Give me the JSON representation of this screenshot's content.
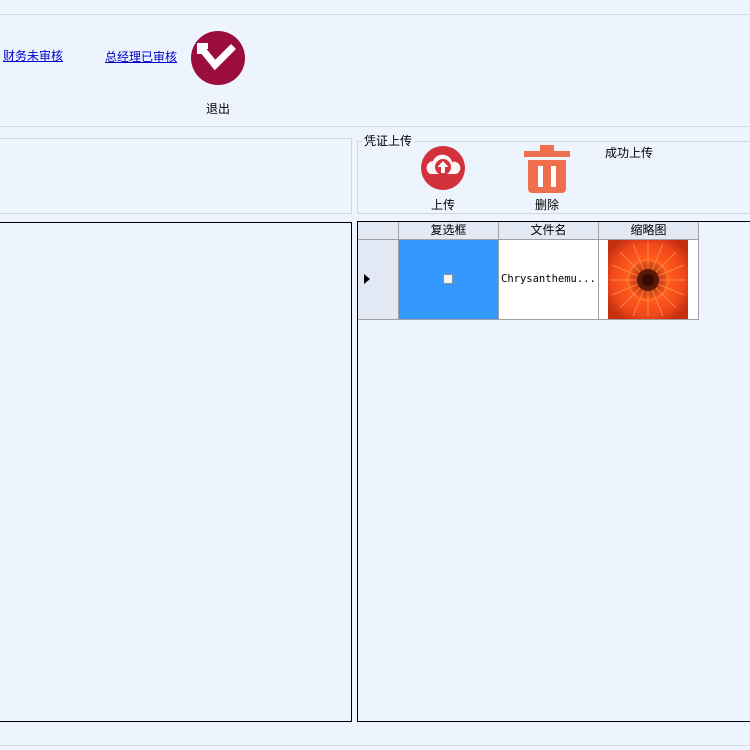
{
  "toolbar": {
    "finance_pending_link": "财务未审核",
    "gm_approved_link": "总经理已审核",
    "exit_label": "退出"
  },
  "voucher_upload": {
    "group_title": "凭证上传",
    "upload_label": "上传",
    "delete_label": "删除",
    "success_label": "成功上传"
  },
  "file_grid": {
    "columns": [
      "复选框",
      "文件名",
      "缩略图"
    ],
    "rows": [
      {
        "checked": false,
        "filename": "Chrysanthemu...",
        "thumbnail": "chrysanthemum-photo"
      }
    ]
  },
  "colors": {
    "background": "#eef4fe",
    "exit_icon": "#9b0d3c",
    "upload_icon": "#d2323c",
    "delete_icon": "#ef6e4e",
    "selected_cell": "#3399ff"
  }
}
